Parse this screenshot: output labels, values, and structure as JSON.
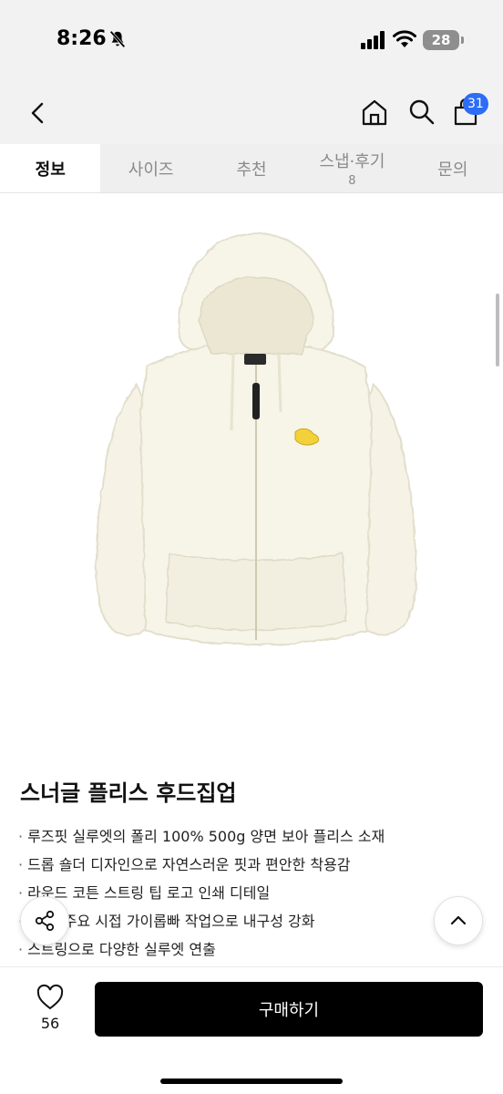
{
  "status": {
    "time": "8:26",
    "battery": "28"
  },
  "nav": {
    "cart_count": "31"
  },
  "tabs": [
    {
      "label": "정보",
      "sub": ""
    },
    {
      "label": "사이즈",
      "sub": ""
    },
    {
      "label": "추천",
      "sub": ""
    },
    {
      "label": "스냅·후기",
      "sub": "8"
    },
    {
      "label": "문의",
      "sub": ""
    }
  ],
  "product": {
    "title": "스너글 플리스 후드집업",
    "features": [
      "루즈핏 실루엣의 폴리 100% 500g 양면 보아 플리스 소재",
      "드롭 숄더 디자인으로 자연스러운 핏과 편안한 착용감",
      "라운드 코튼 스트링 팁 로고 인쇄 디테일",
      "·암홀 주요 시접 가이롭빠 작업으로 내구성 강화",
      "스트링으로 다양한 실루엣 연출"
    ]
  },
  "bottom": {
    "like_count": "56",
    "buy_label": "구매하기"
  },
  "colors": {
    "accent_badge": "#2c6cf6",
    "buy_button": "#000000",
    "product_fleece": "#f6f3e6"
  },
  "icons": [
    "back-icon",
    "home-icon",
    "search-icon",
    "cart-icon",
    "share-icon",
    "chevron-up-icon",
    "heart-icon",
    "bell-off-icon",
    "signal-icon",
    "wifi-icon"
  ]
}
